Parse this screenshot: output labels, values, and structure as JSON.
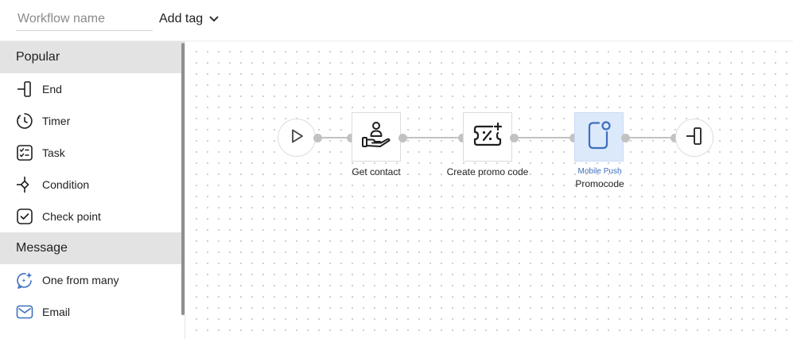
{
  "header": {
    "workflow_name_placeholder": "Workflow name",
    "workflow_name_value": "",
    "add_tag_label": "Add tag"
  },
  "sidebar": {
    "sections": [
      {
        "title": "Popular",
        "items": [
          {
            "label": "End",
            "icon": "end-icon"
          },
          {
            "label": "Timer",
            "icon": "timer-icon"
          },
          {
            "label": "Task",
            "icon": "task-icon"
          },
          {
            "label": "Condition",
            "icon": "condition-icon"
          },
          {
            "label": "Check point",
            "icon": "checkpoint-icon"
          }
        ]
      },
      {
        "title": "Message",
        "items": [
          {
            "label": "One from many",
            "icon": "sparkle-chat-icon"
          },
          {
            "label": "Email",
            "icon": "email-icon"
          }
        ]
      }
    ]
  },
  "canvas": {
    "nodes": [
      {
        "id": "start",
        "kind": "start",
        "icon": "play-icon"
      },
      {
        "id": "get-contact",
        "kind": "action",
        "icon": "hand-person-icon",
        "label": "Get contact"
      },
      {
        "id": "create-promo",
        "kind": "action",
        "icon": "promo-ticket-icon",
        "label": "Create promo code"
      },
      {
        "id": "mobile-push",
        "kind": "message",
        "icon": "mobile-push-icon",
        "sublabel": "Mobile Push",
        "label": "Promocode"
      },
      {
        "id": "end",
        "kind": "end",
        "icon": "end-icon"
      }
    ]
  },
  "colors": {
    "accent": "#3d6fc0",
    "highlight_bg": "#dce9fb",
    "section_bg": "#e3e3e3",
    "edge": "#c2c2c2"
  }
}
